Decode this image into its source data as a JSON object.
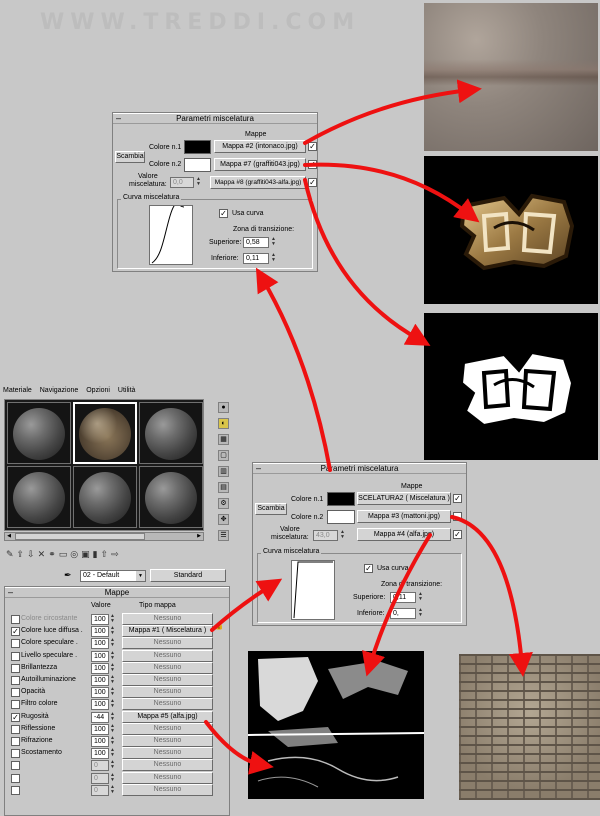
{
  "watermark": "WWW.TREDDI.COM",
  "blend_panel_top": {
    "title": "Parametri miscelatura",
    "maps_header": "Mappe",
    "swap_button": "Scambia",
    "color1_label": "Colore n.1",
    "color1_map": "Mappa #2 (intonaco.jpg)",
    "color2_label": "Colore n.2",
    "color2_map": "Mappa #7 (graffiti043.jpg)",
    "mix_label_1": "Valore",
    "mix_label_2": "miscelatura:",
    "mix_value": "0,0",
    "mix_map": "Mappa #8 (graffiti043-alfa.jpg)",
    "curve_group": "Curva miscelatura",
    "use_curve": "Usa curva",
    "transition_zone": "Zona di transizione:",
    "upper_label": "Superiore:",
    "upper_value": "0,58",
    "lower_label": "Inferiore:",
    "lower_value": "0,11"
  },
  "blend_panel_bottom": {
    "title": "Parametri miscelatura",
    "maps_header": "Mappe",
    "swap_button": "Scambia",
    "color1_label": "Colore n.1",
    "color1_map": "SCELATURA2 ( Miscelatura )",
    "color2_label": "Colore n.2",
    "color2_map": "Mappa #3 (mattoni.jpg)",
    "mix_label_1": "Valore",
    "mix_label_2": "miscelatura:",
    "mix_value": "43,0",
    "mix_map": "Mappa #4 (alfa.jpg)",
    "curve_group": "Curva miscelatura",
    "use_curve": "Usa curva",
    "transition_zone": "Zona di transizione:",
    "upper_label": "Superiore:",
    "upper_value": "0,11",
    "lower_label": "Inferiore:",
    "lower_value": "0,"
  },
  "material_editor": {
    "menu": [
      "Materiale",
      "Navigazione",
      "Opzioni",
      "Utilità"
    ],
    "material_name": "02 - Default",
    "material_type": "Standard",
    "maps_title": "Mappe",
    "col_value": "Valore",
    "col_map_type": "Tipo mappa",
    "rows": [
      {
        "label": "Colore circostante",
        "value": "100",
        "map": "Nessuno",
        "checked": false,
        "dim": true
      },
      {
        "label": "Colore luce diffusa .",
        "value": "100",
        "map": "Mappa #1  ( Miscelatura )",
        "checked": true,
        "dim": false
      },
      {
        "label": "Colore speculare .",
        "value": "100",
        "map": "Nessuno",
        "checked": false,
        "dim": false
      },
      {
        "label": "Livello speculare .",
        "value": "100",
        "map": "Nessuno",
        "checked": false,
        "dim": false
      },
      {
        "label": "Brillantezza",
        "value": "100",
        "map": "Nessuno",
        "checked": false,
        "dim": false
      },
      {
        "label": "Autoilluminazione",
        "value": "100",
        "map": "Nessuno",
        "checked": false,
        "dim": false
      },
      {
        "label": "Opacità",
        "value": "100",
        "map": "Nessuno",
        "checked": false,
        "dim": false
      },
      {
        "label": "Filtro colore",
        "value": "100",
        "map": "Nessuno",
        "checked": false,
        "dim": false
      },
      {
        "label": "Rugosità",
        "value": "-44",
        "map": "Mappa #5 (alfa.jpg)",
        "checked": true,
        "dim": false
      },
      {
        "label": "Riflessione",
        "value": "100",
        "map": "Nessuno",
        "checked": false,
        "dim": false
      },
      {
        "label": "Rifrazione",
        "value": "100",
        "map": "Nessuno",
        "checked": false,
        "dim": false
      },
      {
        "label": "Scostamento",
        "value": "100",
        "map": "Nessuno",
        "checked": false,
        "dim": false
      },
      {
        "label": "",
        "value": "0",
        "map": "Nessuno",
        "checked": false,
        "dim": true
      },
      {
        "label": "",
        "value": "0",
        "map": "Nessuno",
        "checked": false,
        "dim": true
      },
      {
        "label": "",
        "value": "0",
        "map": "Nessuno",
        "checked": false,
        "dim": true
      }
    ]
  },
  "colors": {
    "arrow": "#ee1111",
    "panel_bg": "#c8c8c8",
    "button_bg": "#d4d4d4"
  }
}
